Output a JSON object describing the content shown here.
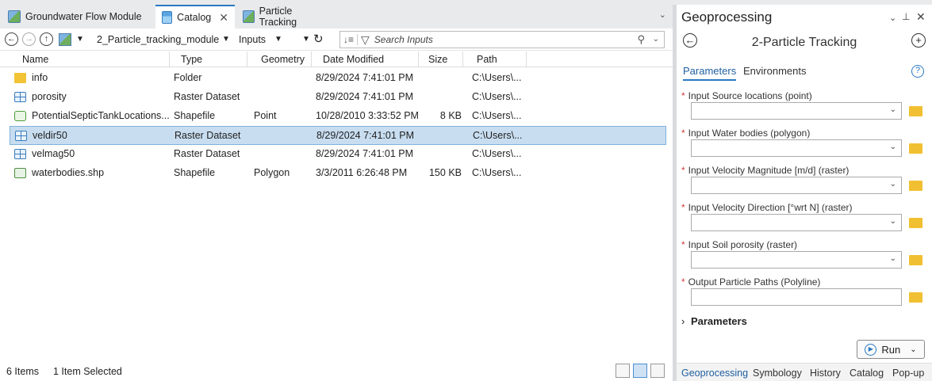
{
  "tabs": [
    {
      "label": "Groundwater Flow Module"
    },
    {
      "label": "Catalog"
    },
    {
      "label": "Particle Tracking"
    }
  ],
  "catalog": {
    "path_folder": "2_Particle_tracking_module",
    "path_sub": "Inputs",
    "search_placeholder": "Search Inputs",
    "headers": [
      "Name",
      "Type",
      "Geometry",
      "Date Modified",
      "Size",
      "Path"
    ],
    "rows": [
      {
        "name": "info",
        "type": "Folder",
        "geometry": "",
        "date": "8/29/2024 7:41:01 PM",
        "size": "",
        "path": "C:\\Users\\...",
        "icon": "folder-icon"
      },
      {
        "name": "porosity",
        "type": "Raster Dataset",
        "geometry": "",
        "date": "8/29/2024 7:41:01 PM",
        "size": "",
        "path": "C:\\Users\\...",
        "icon": "raster-icon"
      },
      {
        "name": "PotentialSepticTankLocations...",
        "type": "Shapefile",
        "geometry": "Point",
        "date": "10/28/2010 3:33:52 PM",
        "size": "8 KB",
        "path": "C:\\Users\\...",
        "icon": "point-shapefile-icon"
      },
      {
        "name": "veldir50",
        "type": "Raster Dataset",
        "geometry": "",
        "date": "8/29/2024 7:41:01 PM",
        "size": "",
        "path": "C:\\Users\\...",
        "icon": "raster-icon",
        "selected": true
      },
      {
        "name": "velmag50",
        "type": "Raster Dataset",
        "geometry": "",
        "date": "8/29/2024 7:41:01 PM",
        "size": "",
        "path": "C:\\Users\\...",
        "icon": "raster-icon"
      },
      {
        "name": "waterbodies.shp",
        "type": "Shapefile",
        "geometry": "Polygon",
        "date": "3/3/2011 6:26:48 PM",
        "size": "150 KB",
        "path": "C:\\Users\\...",
        "icon": "polygon-shapefile-icon"
      }
    ],
    "status_items": "6 Items",
    "status_selected": "1 Item Selected"
  },
  "gp": {
    "title": "Geoprocessing",
    "tool": "2-Particle Tracking",
    "tab_parameters": "Parameters",
    "tab_environments": "Environments",
    "params": [
      "Input Source locations (point)",
      "Input Water bodies (polygon)",
      "Input Velocity Magnitude [m/d] (raster)",
      "Input Velocity Direction [°wrt N] (raster)",
      "Input Soil porosity (raster)",
      "Output Particle Paths (Polyline)"
    ],
    "params_section": "Parameters",
    "run": "Run",
    "bottom_tabs": [
      "Geoprocessing",
      "Symbology",
      "History",
      "Catalog",
      "Pop-up"
    ]
  }
}
